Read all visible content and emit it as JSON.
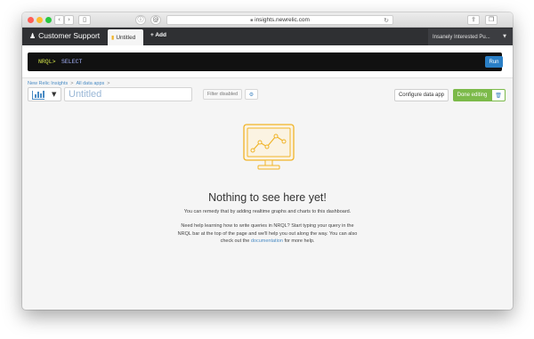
{
  "browser": {
    "url": "insights.newrelic.com",
    "colors": {
      "close": "#ff5f57",
      "minimize": "#febc2e",
      "maximize": "#28c840"
    }
  },
  "app": {
    "brand": "Customer Support",
    "active_tab": "Untitled",
    "add_label": "+ Add",
    "account_name": "Insanely Interested Pu..."
  },
  "nrql": {
    "prompt": "NRQL>",
    "query": "SELECT",
    "run_label": "Run"
  },
  "breadcrumb": {
    "items": [
      "New Relic Insights",
      "All data apps"
    ],
    "separator": ">"
  },
  "dashboard": {
    "title_placeholder": "Untitled",
    "filter_label": "Filter disabled",
    "configure_label": "Configure data app",
    "done_label": "Done editing"
  },
  "empty_state": {
    "heading": "Nothing to see here yet!",
    "line1": "You can remedy that by adding realtime graphs and charts to this dashboard.",
    "line2_pre": "Need help learning how to write queries in NRQL? Start typing your query in the NRQL bar at the top of the page and we'll help you out along the way. You can also check out the",
    "link_text": "documentation",
    "line2_post": "for more help."
  },
  "colors": {
    "header_bg": "#2f3033",
    "accent_blue": "#4a8bc4",
    "run_blue": "#2a7fc6",
    "done_green": "#7cba4a",
    "illustration_orange": "#f0b429"
  }
}
